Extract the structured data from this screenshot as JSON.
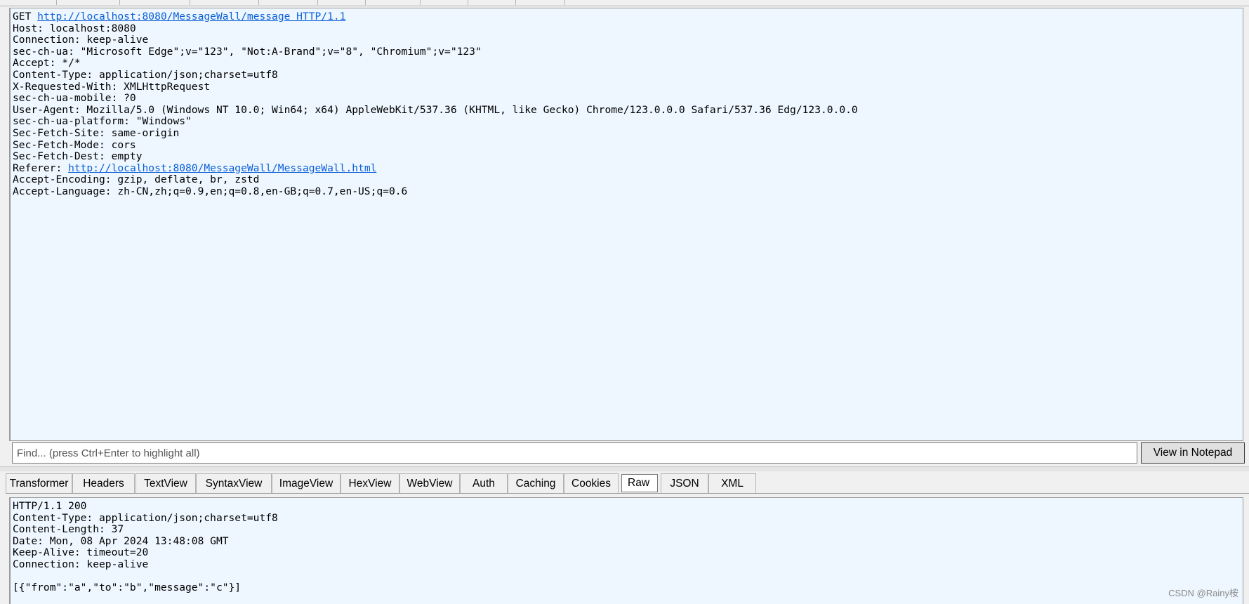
{
  "request": {
    "request_line_method": "GET ",
    "request_line_url": "http://localhost:8080/MessageWall/message HTTP/1.1",
    "header_lines_1": [
      "Host: localhost:8080",
      "Connection: keep-alive",
      "sec-ch-ua: \"Microsoft Edge\";v=\"123\", \"Not:A-Brand\";v=\"8\", \"Chromium\";v=\"123\"",
      "Accept: */*",
      "Content-Type: application/json;charset=utf8",
      "X-Requested-With: XMLHttpRequest",
      "sec-ch-ua-mobile: ?0",
      "User-Agent: Mozilla/5.0 (Windows NT 10.0; Win64; x64) AppleWebKit/537.36 (KHTML, like Gecko) Chrome/123.0.0.0 Safari/537.36 Edg/123.0.0.0",
      "sec-ch-ua-platform: \"Windows\"",
      "Sec-Fetch-Site: same-origin",
      "Sec-Fetch-Mode: cors",
      "Sec-Fetch-Dest: empty"
    ],
    "referer_label": "Referer: ",
    "referer_url": "http://localhost:8080/MessageWall/MessageWall.html",
    "header_lines_2": [
      "Accept-Encoding: gzip, deflate, br, zstd",
      "Accept-Language: zh-CN,zh;q=0.9,en;q=0.8,en-GB;q=0.7,en-US;q=0.6"
    ]
  },
  "find": {
    "placeholder": "Find... (press Ctrl+Enter to highlight all)",
    "notepad_label": "View in Notepad"
  },
  "response_tabs": [
    "Transformer",
    "Headers",
    "TextView",
    "SyntaxView",
    "ImageView",
    "HexView",
    "WebView",
    "Auth",
    "Caching",
    "Cookies",
    "Raw",
    "JSON",
    "XML"
  ],
  "active_response_tab": "Raw",
  "response": {
    "lines": [
      "HTTP/1.1 200",
      "Content-Type: application/json;charset=utf8",
      "Content-Length: 37",
      "Date: Mon, 08 Apr 2024 13:48:08 GMT",
      "Keep-Alive: timeout=20",
      "Connection: keep-alive",
      "",
      "[{\"from\":\"a\",\"to\":\"b\",\"message\":\"c\"}]"
    ]
  },
  "watermark": "CSDN @Rainy桉",
  "colors": {
    "panel_bg": "#eef7ff",
    "link": "#0b5fd8",
    "chrome_bg": "#f0f0f0"
  }
}
